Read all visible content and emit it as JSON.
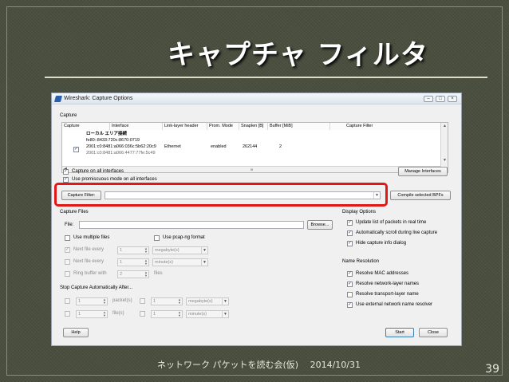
{
  "slide": {
    "title": "キャプチャ フィルタ",
    "footer": "ネットワーク パケットを読む会(仮)　 2014/10/31",
    "page_number": "39"
  },
  "window": {
    "title": "Wireshark: Capture Options",
    "icon": "wireshark-fin-icon",
    "controls": [
      "minimize-icon",
      "maximize-icon",
      "close-icon"
    ]
  },
  "capture": {
    "section_label": "Capture",
    "columns": [
      "Capture",
      "Interface",
      "Link-layer header",
      "Prom. Mode",
      "Snaplen [B]",
      "Buffer [MiB]",
      "Capture Filter"
    ],
    "row": {
      "checked": true,
      "interface_name": "ローカル エリア接続",
      "interface_addr1": "fe80::8433:720c:8670:0719",
      "interface_addr2": "2001:c0:8481:a066:036c:5b62:20c9",
      "interface_addr3": "2001:c0:8481:a066:4477:77fe:5c49",
      "link_layer": "Ethernet",
      "prom_mode": "enabled",
      "snaplen": "262144",
      "buffer": "2",
      "capture_filter": ""
    },
    "hscroll_thumb": "III",
    "capture_all_label": "Capture on all interfaces",
    "capture_all_checked": true,
    "promiscuous_label": "Use promiscuous mode on all interfaces",
    "promiscuous_checked": true,
    "manage_interfaces_label": "Manage Interfaces",
    "capture_filter_button": "Capture Filter:",
    "capture_filter_value": "",
    "compile_bpfs_label": "Compile selected BPFs"
  },
  "capture_files": {
    "section_label": "Capture Files",
    "file_label": "File:",
    "file_value": "",
    "browse_label": "Browse...",
    "use_multiple_files": "Use multiple files",
    "use_pcapng": "Use pcap-ng format",
    "next_file_every_1": "Next file every",
    "next_file_every_1_value": "1",
    "next_file_every_1_unit": "megabyte(s)",
    "next_file_every_2": "Next file every",
    "next_file_every_2_value": "1",
    "next_file_every_2_unit": "minute(s)",
    "ring_buffer": "Ring buffer with",
    "ring_buffer_value": "2",
    "ring_buffer_unit": "files"
  },
  "stop_capture": {
    "section_label": "Stop Capture Automatically After...",
    "row1_value_a": "1",
    "row1_unit_a": "packet(s)",
    "row1_value_b": "1",
    "row1_unit_b": "megabyte(s)",
    "row2_value_a": "1",
    "row2_unit_a": "file(s)",
    "row2_value_b": "1",
    "row2_unit_b": "minute(s)"
  },
  "display_options": {
    "section_label": "Display Options",
    "update_list": "Update list of packets in real time",
    "auto_scroll": "Automatically scroll during live capture",
    "hide_info": "Hide capture info dialog"
  },
  "name_resolution": {
    "section_label": "Name Resolution",
    "resolve_mac": "Resolve MAC addresses",
    "resolve_network": "Resolve network-layer names",
    "resolve_transport": "Resolve transport-layer name",
    "use_external": "Use external network name resolver"
  },
  "buttons": {
    "help": "Help",
    "start": "Start",
    "close": "Close"
  },
  "colors": {
    "highlight": "#e01818",
    "slide_background": "#4a4e3e"
  }
}
